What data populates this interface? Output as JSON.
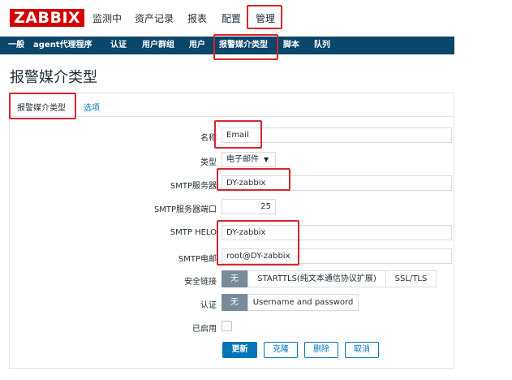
{
  "app": {
    "logo": "ZABBIX",
    "top_menu": [
      "监测中",
      "资产记录",
      "报表",
      "配置",
      "管理"
    ],
    "sub_menu": [
      "一般",
      "agent代理程序",
      "认证",
      "用户群组",
      "用户",
      "报警媒介类型",
      "脚本",
      "队列"
    ]
  },
  "page": {
    "title": "报警媒介类型"
  },
  "tabs": [
    "报警媒介类型",
    "选项"
  ],
  "form": {
    "name_label": "名称",
    "name_value": "Email",
    "type_label": "类型",
    "type_value": "电子邮件",
    "smtp_server_label": "SMTP服务器",
    "smtp_server_value": "DY-zabbix",
    "smtp_port_label": "SMTP服务器端口",
    "smtp_port_value": "25",
    "smtp_helo_label": "SMTP HELO",
    "smtp_helo_value": "DY-zabbix",
    "smtp_email_label": "SMTP电邮",
    "smtp_email_value": "root@DY-zabbix",
    "security_label": "安全链接",
    "security_options": [
      "无",
      "STARTTLS(纯文本通信协议扩展)",
      "SSL/TLS"
    ],
    "auth_label": "认证",
    "auth_options": [
      "无",
      "Username and password"
    ],
    "enabled_label": "已启用",
    "enabled": false
  },
  "buttons": {
    "update": "更新",
    "clone": "克隆",
    "delete": "删除",
    "cancel": "取消"
  },
  "colors": {
    "accent": "#0275b8",
    "nav": "#0a466a",
    "logo": "#d40000",
    "highlight": "#d8262c"
  }
}
